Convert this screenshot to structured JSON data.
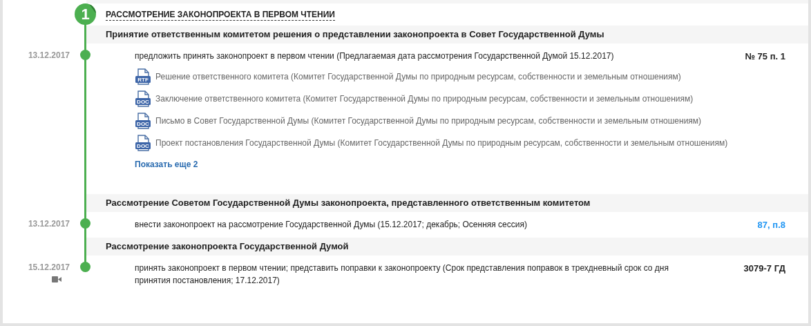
{
  "stage": {
    "number": "1",
    "title": "РАССМОТРЕНИЕ ЗАКОНОПРОЕКТА В ПЕРВОМ ЧТЕНИИ"
  },
  "events": [
    {
      "title": "Принятие ответственным комитетом решения о представлении законопроекта в Совет Государственной Думы",
      "date": "13.12.2017",
      "video": false,
      "text": "предложить принять законопроект в первом чтении (Предлагаемая дата рассмотрения Государственной Думой 15.12.2017)",
      "ref": "№ 75 п. 1",
      "ref_is_link": false,
      "documents": [
        {
          "type": "RTF",
          "text": "Решение ответственного комитета (Комитет Государственной Думы по природным ресурсам, собственности и земельным отношениям)"
        },
        {
          "type": "DOC",
          "text": "Заключение ответственного комитета (Комитет Государственной Думы по природным ресурсам, собственности и земельным отношениям)"
        },
        {
          "type": "DOC",
          "text": "Письмо в Совет Государственной Думы (Комитет Государственной Думы по природным ресурсам, собственности и земельным отношениям)"
        },
        {
          "type": "DOC",
          "text": "Проект постановления Государственной Думы (Комитет Государственной Думы по природным ресурсам, собственности и земельным отношениям)"
        }
      ],
      "more_link": "Показать еще 2"
    },
    {
      "title": "Рассмотрение Советом Государственной Думы законопроекта, представленного ответственным комитетом",
      "date": "13.12.2017",
      "video": false,
      "text": "внести законопроект на рассмотрение Государственной Думы (15.12.2017; декабрь; Осенняя сессия)",
      "ref": "87, п.8",
      "ref_is_link": true
    },
    {
      "title": "Рассмотрение законопроекта Государственной Думой",
      "date": "15.12.2017",
      "video": true,
      "text": "принять законопроект в первом чтении; представить поправки к законопроекту (Срок представления поправок в трехдневный срок со дня принятия постановления; 17.12.2017)",
      "ref": "3079-7 ГД",
      "ref_is_link": false
    }
  ]
}
